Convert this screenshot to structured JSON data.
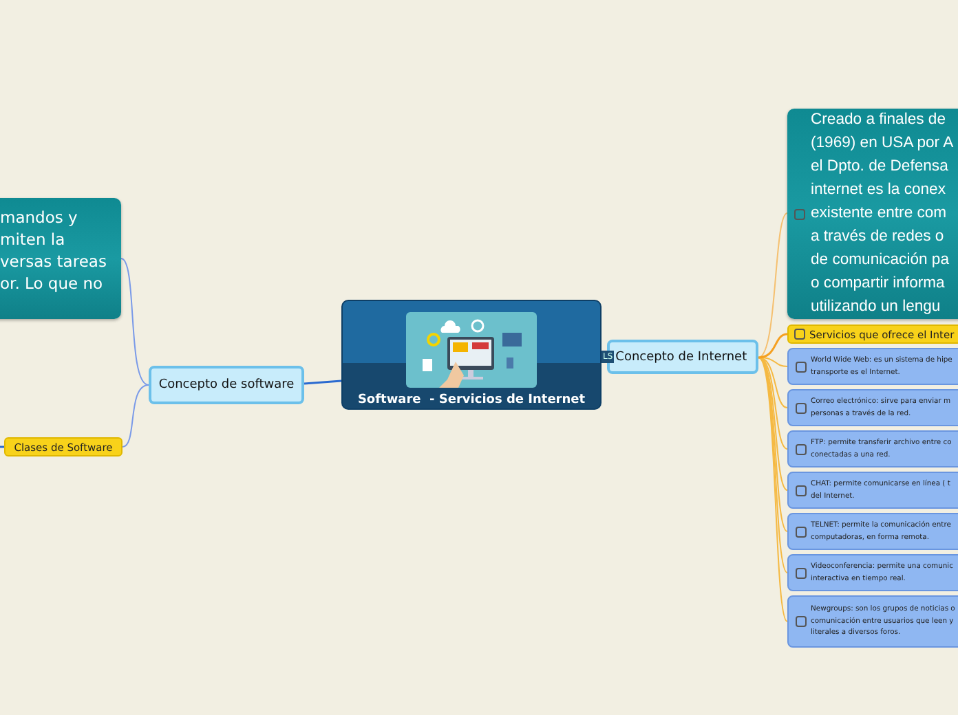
{
  "central_topic": {
    "title": "Software  - Servicios de Internet"
  },
  "left_branch": {
    "label": "Concepto de software",
    "description_lines": [
      "mandos y",
      "miten la",
      "versas tareas",
      "or. Lo que no"
    ],
    "subtopic": "Clases de Software"
  },
  "right_branch": {
    "label": "Concepto de Internet",
    "badge": "LS",
    "description_lines": [
      "Creado a finales de",
      "(1969) en USA por A",
      "el Dpto. de Defensa",
      "internet es la conex",
      "existente entre com",
      "a través de redes o",
      "de comunicación pa",
      "o compartir informa",
      "utilizando un lengu"
    ],
    "services_heading": "Servicios que ofrece el Inter",
    "services": [
      {
        "lines": [
          "World Wide Web: es un sistema de hipe",
          "transporte es el Internet."
        ]
      },
      {
        "lines": [
          "Correo electrónico: sirve para enviar m",
          "personas a través de la red."
        ]
      },
      {
        "lines": [
          "FTP: permite transferir archivo entre co",
          "conectadas a una red."
        ]
      },
      {
        "lines": [
          "CHAT: permite comunicarse en línea ( t",
          "del Internet."
        ]
      },
      {
        "lines": [
          "TELNET: permite la comunicación entre",
          "computadoras, en forma remota."
        ]
      },
      {
        "lines": [
          "Videoconferencia: permite una comunic",
          "interactiva en tiempo real."
        ]
      },
      {
        "lines": [
          "Newgroups: son los grupos de noticias o",
          "comunicación entre usuarios que leen y",
          "literales a diversos foros."
        ]
      }
    ]
  }
}
